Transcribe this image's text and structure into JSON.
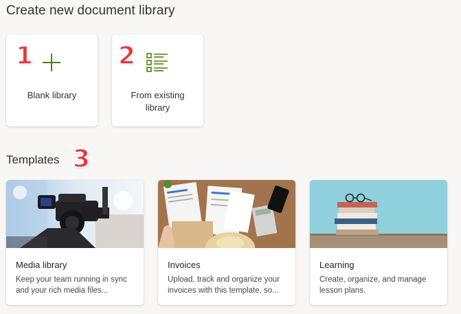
{
  "page": {
    "title": "Create new document library"
  },
  "create_options": [
    {
      "label": "Blank library",
      "icon": "plus-icon",
      "badge": "1"
    },
    {
      "label": "From existing library",
      "icon": "list-icon",
      "badge": "2"
    }
  ],
  "templates_section": {
    "title": "Templates",
    "badge": "3"
  },
  "templates": [
    {
      "name": "Media library",
      "description": "Keep your team running in sync and your rich media files...",
      "thumbnail": "camera-image"
    },
    {
      "name": "Invoices",
      "description": "Upload, track and organize your invoices with this template, so...",
      "thumbnail": "invoices-image"
    },
    {
      "name": "Learning",
      "description": "Create, organize, and manage lesson plans.",
      "thumbnail": "books-image"
    }
  ],
  "colors": {
    "accent_green": "#498205",
    "badge_red": "#e8363c",
    "background": "#f8f7f6"
  }
}
